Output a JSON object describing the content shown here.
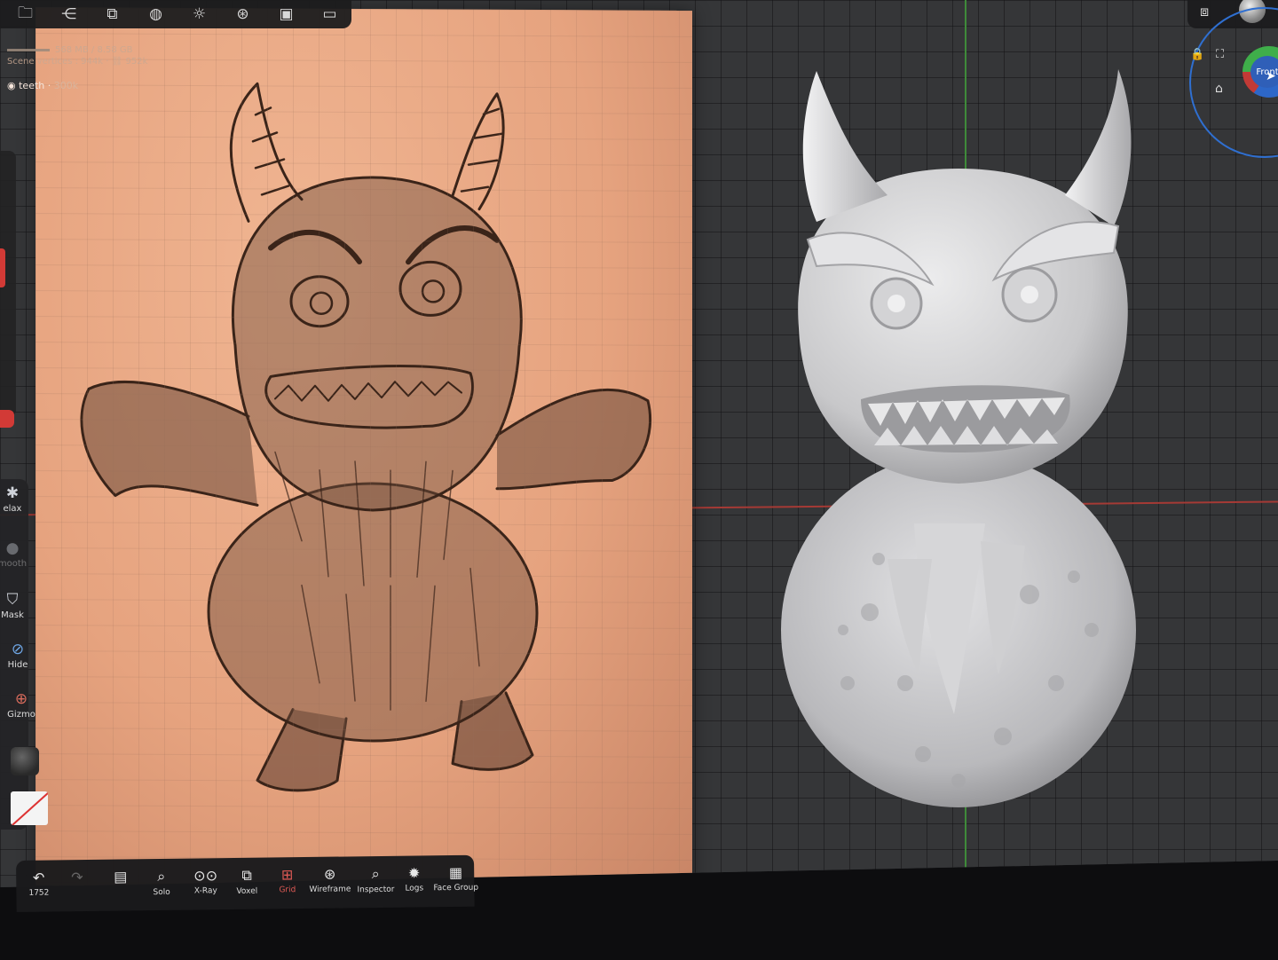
{
  "top_toolbar": {
    "icons": [
      "folder-icon",
      "share-nodes-icon",
      "cubes-icon",
      "material-sphere-icon",
      "sun-icon",
      "aperture-icon",
      "image-icon",
      "camera-icon"
    ]
  },
  "stats": {
    "memory": "568 MB / 8.58 GB",
    "vertices_label": "Scene vertices :",
    "vertices_value": "944k",
    "vertices_extra": "952k"
  },
  "object": {
    "name": "teeth",
    "count": "300k"
  },
  "left_toolbar": {
    "items": [
      {
        "label": "elax",
        "icon": "relax-icon"
      },
      {
        "label": "mooth",
        "icon": "smooth-icon"
      },
      {
        "label": "Mask",
        "icon": "mask-icon"
      },
      {
        "label": "Hide",
        "icon": "hide-icon"
      },
      {
        "label": "Gizmo",
        "icon": "gizmo-icon"
      }
    ]
  },
  "bottom_toolbar": {
    "undo_count": "1752",
    "items": [
      {
        "label": "Solo",
        "icon": "search-icon"
      },
      {
        "label": "X-Ray",
        "icon": "glasses-icon"
      },
      {
        "label": "Voxel",
        "icon": "voxel-icon"
      },
      {
        "label": "Grid",
        "icon": "grid-icon",
        "active": true
      },
      {
        "label": "Wireframe",
        "icon": "wireframe-icon"
      },
      {
        "label": "Inspector",
        "icon": "inspector-icon"
      },
      {
        "label": "Logs",
        "icon": "bug-icon"
      },
      {
        "label": "Face Group",
        "icon": "face-group-icon"
      }
    ]
  },
  "navigation": {
    "cube_label": "Front"
  },
  "colors": {
    "axis_x": "#a53a35",
    "axis_y": "#3f8b3a",
    "active_red": "#e05a55",
    "gizmo_blue": "#2f6fd0"
  }
}
